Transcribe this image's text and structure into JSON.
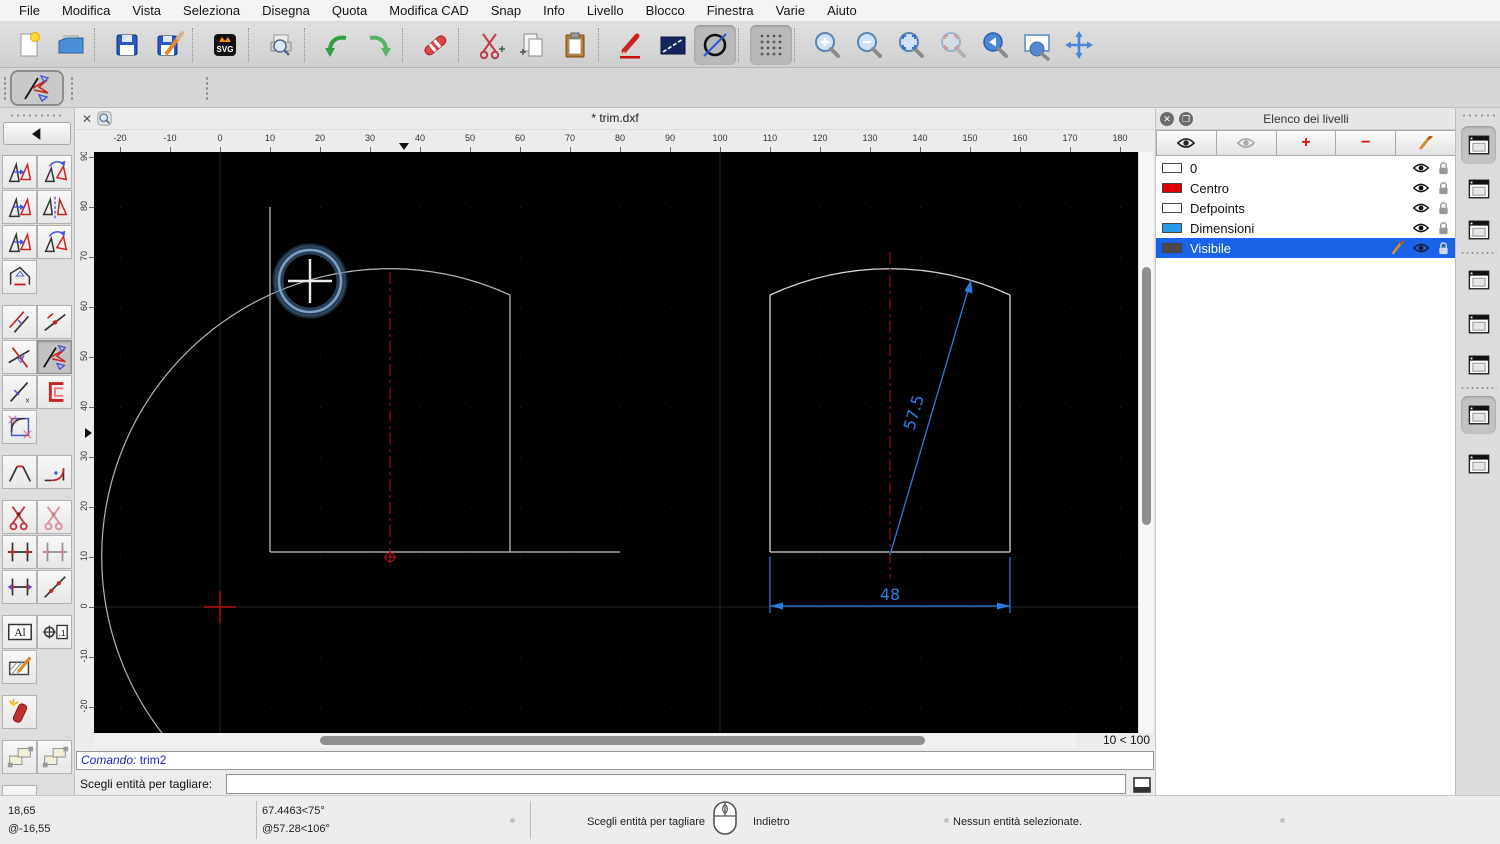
{
  "menu": {
    "items": [
      "File",
      "Modifica",
      "Vista",
      "Seleziona",
      "Disegna",
      "Quota",
      "Modifica CAD",
      "Snap",
      "Info",
      "Livello",
      "Blocco",
      "Finestra",
      "Varie",
      "Aiuto"
    ]
  },
  "toolbar": {
    "groups": [
      [
        {
          "name": "new-file-button",
          "icon": "new"
        },
        {
          "name": "open-file-button",
          "icon": "open"
        }
      ],
      [
        {
          "name": "save-button",
          "icon": "save"
        },
        {
          "name": "save-as-button",
          "icon": "saveas"
        }
      ],
      [
        {
          "name": "svg-export-button",
          "icon": "svg"
        }
      ],
      [
        {
          "name": "print-preview-button",
          "icon": "preview"
        }
      ],
      [
        {
          "name": "undo-button",
          "icon": "undo"
        },
        {
          "name": "redo-button",
          "icon": "redo"
        }
      ],
      [
        {
          "name": "delete-entities-button",
          "icon": "eraser"
        }
      ],
      [
        {
          "name": "cut-button",
          "icon": "cut"
        },
        {
          "name": "copy-button",
          "icon": "copy"
        },
        {
          "name": "paste-button",
          "icon": "paste"
        }
      ],
      [
        {
          "name": "pen-attributes-button",
          "icon": "pen"
        },
        {
          "name": "entity-attributes-button",
          "icon": "rectdiag"
        },
        {
          "name": "circle-tool-button",
          "icon": "circlediag",
          "pressed": true
        }
      ],
      [
        {
          "name": "grid-toggle-button",
          "icon": "grid",
          "pressed": true
        }
      ],
      [
        {
          "name": "zoom-in-button",
          "icon": "zoomin"
        },
        {
          "name": "zoom-out-button",
          "icon": "zoomout"
        },
        {
          "name": "zoom-auto-button",
          "icon": "zoomauto"
        },
        {
          "name": "zoom-previous-button",
          "icon": "zoomprev",
          "disabled": true
        },
        {
          "name": "zoom-back-button",
          "icon": "zoomback"
        },
        {
          "name": "zoom-window-button",
          "icon": "zoomwin"
        },
        {
          "name": "zoom-pan-button",
          "icon": "zoompan"
        }
      ]
    ]
  },
  "tool_options": {
    "active_tool": "trim-two"
  },
  "sidebar": {
    "rows": [
      {
        "gap": false,
        "items": [
          {
            "name": "tool-move-copy",
            "icon": "mod"
          },
          {
            "name": "tool-rotate",
            "icon": "modr"
          }
        ]
      },
      {
        "gap": false,
        "items": [
          {
            "name": "tool-scale",
            "icon": "mod"
          },
          {
            "name": "tool-mirror",
            "icon": "mirror"
          }
        ]
      },
      {
        "gap": false,
        "items": [
          {
            "name": "tool-move-rotate",
            "icon": "mod"
          },
          {
            "name": "tool-rotate-two",
            "icon": "modr"
          }
        ]
      },
      {
        "gap": false,
        "items": [
          {
            "name": "tool-revert-direction",
            "icon": "revert"
          }
        ]
      },
      {
        "gap": true,
        "items": [
          {
            "name": "tool-offset",
            "icon": "linesoff"
          },
          {
            "name": "tool-split-line",
            "icon": "linedot"
          }
        ]
      },
      {
        "gap": false,
        "items": [
          {
            "name": "tool-trim",
            "icon": "trim"
          },
          {
            "name": "tool-trim-two",
            "icon": "trim2",
            "pressed": true
          }
        ]
      },
      {
        "gap": false,
        "items": [
          {
            "name": "tool-lengthen",
            "icon": "lengthen"
          },
          {
            "name": "tool-offset-shape",
            "icon": "cshape"
          }
        ]
      },
      {
        "gap": false,
        "items": [
          {
            "name": "tool-remove-segment",
            "icon": "arcbox"
          }
        ]
      },
      {
        "gap": true,
        "items": [
          {
            "name": "tool-bevel",
            "icon": "bevel"
          },
          {
            "name": "tool-fillet",
            "icon": "fillet"
          }
        ]
      },
      {
        "gap": true,
        "items": [
          {
            "name": "tool-divide",
            "icon": "scissors"
          },
          {
            "name": "tool-divide-two",
            "icon": "scissors",
            "dim": true
          }
        ]
      },
      {
        "gap": false,
        "items": [
          {
            "name": "tool-cut-intersection",
            "icon": "crossticks"
          },
          {
            "name": "tool-cut-intersection-manual",
            "icon": "crossticks",
            "dim": true
          }
        ]
      },
      {
        "gap": false,
        "items": [
          {
            "name": "tool-stretch",
            "icon": "stretch"
          },
          {
            "name": "tool-split-segments",
            "icon": "splitline"
          }
        ]
      },
      {
        "gap": true,
        "items": [
          {
            "name": "tool-edit-text",
            "icon": "textal"
          },
          {
            "name": "tool-edit-attributes",
            "icon": "attr"
          }
        ]
      },
      {
        "gap": false,
        "items": [
          {
            "name": "tool-edit-hatch",
            "icon": "hatch"
          }
        ]
      },
      {
        "gap": true,
        "items": [
          {
            "name": "tool-explode",
            "icon": "explode"
          }
        ]
      },
      {
        "gap": true,
        "items": [
          {
            "name": "tool-deselect-contour",
            "icon": "sel"
          },
          {
            "name": "tool-select-contour",
            "icon": "sel"
          }
        ]
      },
      {
        "gap": true,
        "items": [
          {
            "name": "tool-paint",
            "icon": "roller"
          }
        ]
      }
    ]
  },
  "doc": {
    "tab_title": "* trim.dxf",
    "close_glyph": "✕"
  },
  "rulers": {
    "h_labels": [
      "-20",
      "-10",
      "0",
      "10",
      "20",
      "30",
      "40",
      "50",
      "60",
      "70",
      "80",
      "90",
      "100",
      "110",
      "120",
      "130",
      "140",
      "150",
      "160",
      "170",
      "180"
    ],
    "v_labels": [
      "90",
      "80",
      "70",
      "60",
      "50",
      "40",
      "30",
      "20",
      "10",
      "0",
      "-10",
      "-20"
    ]
  },
  "drawing": {
    "dim_diagonal": "57.5",
    "dim_width": "48",
    "grid_status": "10 < 100"
  },
  "colors": {
    "dimension_blue": "#2a7de2",
    "centerline_red": "#8b1111",
    "entity_gray": "#c9c9c9",
    "selection_blue": "#1a63e8"
  },
  "layers_panel": {
    "title": "Elenco dei livelli",
    "buttons": [
      {
        "name": "show-all-layers-button",
        "icon": "eye",
        "color": "#222"
      },
      {
        "name": "hide-all-layers-button",
        "icon": "eye",
        "color": "#a8a8a8"
      },
      {
        "name": "add-layer-button",
        "glyph": "+",
        "color": "#d41111"
      },
      {
        "name": "remove-layer-button",
        "glyph": "−",
        "color": "#d41111"
      },
      {
        "name": "edit-layer-button",
        "icon": "pencil",
        "color": "#d98a2b"
      }
    ],
    "layers": [
      {
        "name": "0",
        "color": "#ffffff",
        "selected": false
      },
      {
        "name": "Centro",
        "color": "#e00000",
        "selected": false
      },
      {
        "name": "Defpoints",
        "color": "#ffffff",
        "selected": false
      },
      {
        "name": "Dimensioni",
        "color": "#229ceb",
        "selected": false
      },
      {
        "name": "Visibile",
        "color": "#4a4a4a",
        "selected": true
      }
    ]
  },
  "right_dock": {
    "buttons": [
      {
        "name": "dock-layer-list-toggle",
        "pressed": true
      },
      {
        "name": "dock-block-list-toggle",
        "pressed": false
      },
      {
        "name": "dock-library-browser-toggle",
        "pressed": false
      },
      "sep",
      {
        "name": "dock-entity-list-toggle",
        "pressed": false
      },
      {
        "name": "dock-selection-filter-toggle",
        "pressed": false
      },
      {
        "name": "dock-pen-palette-toggle",
        "pressed": false
      },
      "sep",
      {
        "name": "dock-command-line-toggle",
        "pressed": true
      },
      {
        "name": "dock-clipboard-toggle",
        "pressed": false
      }
    ]
  },
  "command": {
    "label": "Comando:",
    "value": "trim2",
    "prompt": "Scegli entità per tagliare:",
    "input": ""
  },
  "status": {
    "coord_abs": "18,65",
    "coord_rel": "@-16,55",
    "angle_abs": "67.4463<75°",
    "angle_rel": "@57.28<106°",
    "left_hint": "Scegli entità per tagliare",
    "right_hint": "Indietro",
    "selection": "Nessun entità selezionate."
  }
}
